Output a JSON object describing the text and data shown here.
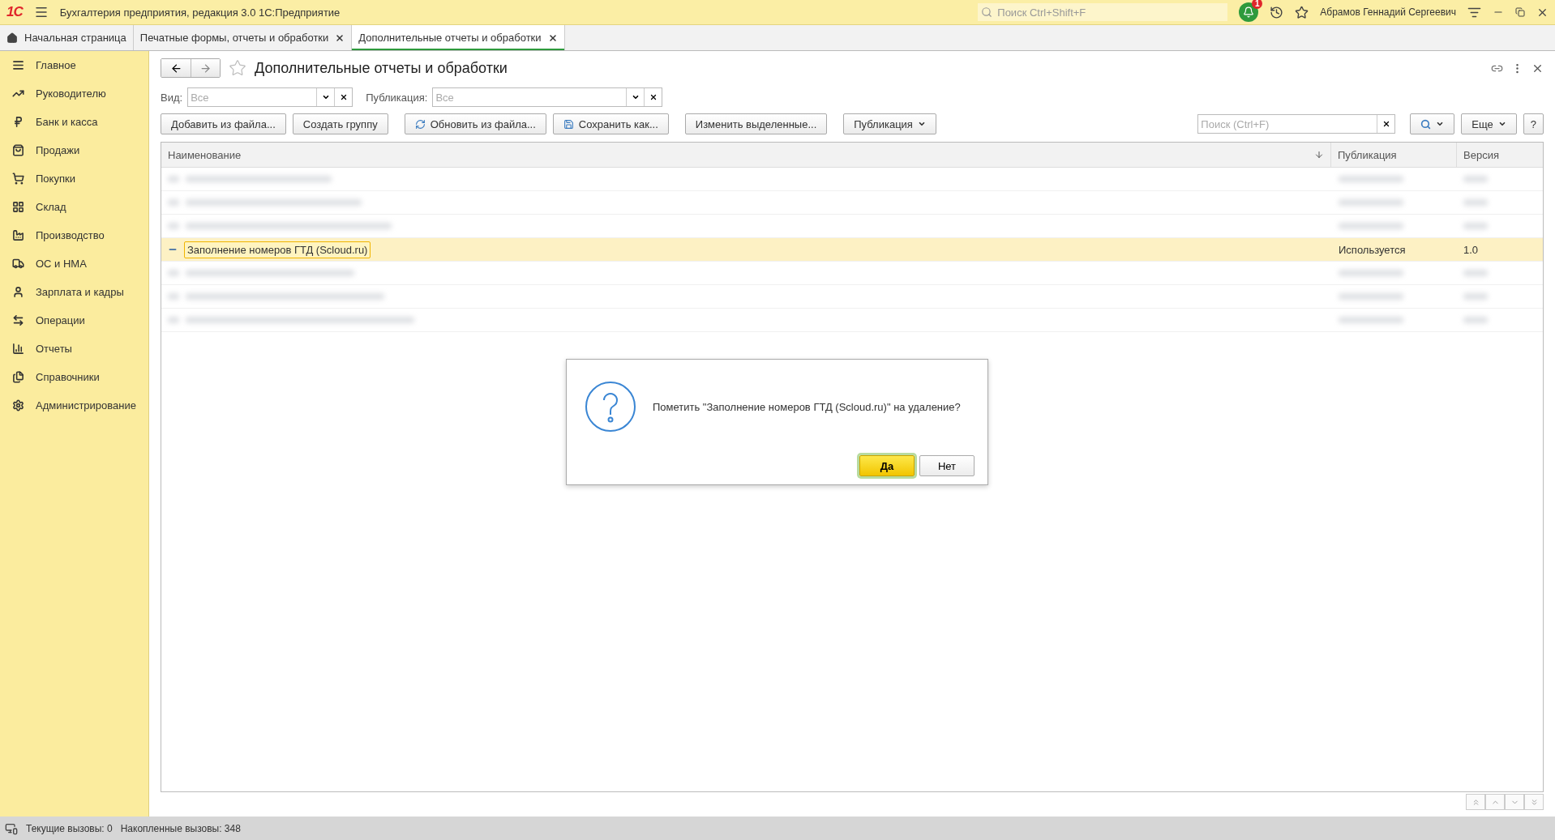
{
  "app_bar": {
    "logo": "1С",
    "title": "Бухгалтерия предприятия, редакция 3.0 1С:Предприятие",
    "search": {
      "placeholder": "Поиск Ctrl+Shift+F"
    },
    "notifications": "1",
    "user": "Абрамов Геннадий Сергеевич"
  },
  "tabs": [
    {
      "label": "Начальная страница",
      "kind": "home",
      "selected": false
    },
    {
      "label": "Печатные формы, отчеты и обработки",
      "kind": "page",
      "selected": false
    },
    {
      "label": "Дополнительные отчеты и обработки",
      "kind": "page",
      "selected": true
    }
  ],
  "sidebar": {
    "items": [
      {
        "label": "Главное"
      },
      {
        "label": "Руководителю"
      },
      {
        "label": "Банк и касса"
      },
      {
        "label": "Продажи"
      },
      {
        "label": "Покупки"
      },
      {
        "label": "Склад"
      },
      {
        "label": "Производство"
      },
      {
        "label": "ОС и НМА"
      },
      {
        "label": "Зарплата и кадры"
      },
      {
        "label": "Операции"
      },
      {
        "label": "Отчеты"
      },
      {
        "label": "Справочники"
      },
      {
        "label": "Администрирование"
      }
    ]
  },
  "form": {
    "title": "Дополнительные отчеты и обработки",
    "filters": [
      {
        "label": "Вид:",
        "placeholder": "Все"
      },
      {
        "label": "Публикация:",
        "placeholder": "Все"
      }
    ],
    "toolbar": [
      {
        "label": "Добавить из файла...",
        "kind": "plain"
      },
      {
        "label": "Создать группу",
        "kind": "plain"
      },
      {
        "label": "Обновить из файла...",
        "kind": "icon"
      },
      {
        "label": "Сохранить как...",
        "kind": "icon"
      },
      {
        "label": "Изменить выделенные...",
        "kind": "plain"
      },
      {
        "label": "Публикация",
        "kind": "dropdown"
      }
    ],
    "search": {
      "placeholder": "Поиск (Ctrl+F)"
    },
    "more_button": "Еще",
    "help_button": "?",
    "table": {
      "columns": [
        "Наименование",
        "Публикация",
        "Версия"
      ],
      "rows": [
        {
          "kind": "blurred",
          "selected": false
        },
        {
          "kind": "blurred",
          "selected": false
        },
        {
          "kind": "blurred",
          "selected": false
        },
        {
          "kind": "item",
          "selected": true,
          "name": "Заполнение номеров ГТД (Scloud.ru)",
          "publication": "Используется",
          "version": "1.0"
        },
        {
          "kind": "blurred",
          "selected": false
        },
        {
          "kind": "blurred",
          "selected": false
        },
        {
          "kind": "blurred",
          "selected": false
        }
      ]
    }
  },
  "dialog": {
    "message": "Пометить \"Заполнение номеров ГТД (Scloud.ru)\" на удаление?",
    "buttons": [
      {
        "label": "Да",
        "selected": true
      },
      {
        "label": "Нет",
        "selected": false
      }
    ]
  },
  "status_bar": {
    "current_calls": "Текущие вызовы: 0",
    "total_calls": "Накопленные вызовы: 348"
  }
}
